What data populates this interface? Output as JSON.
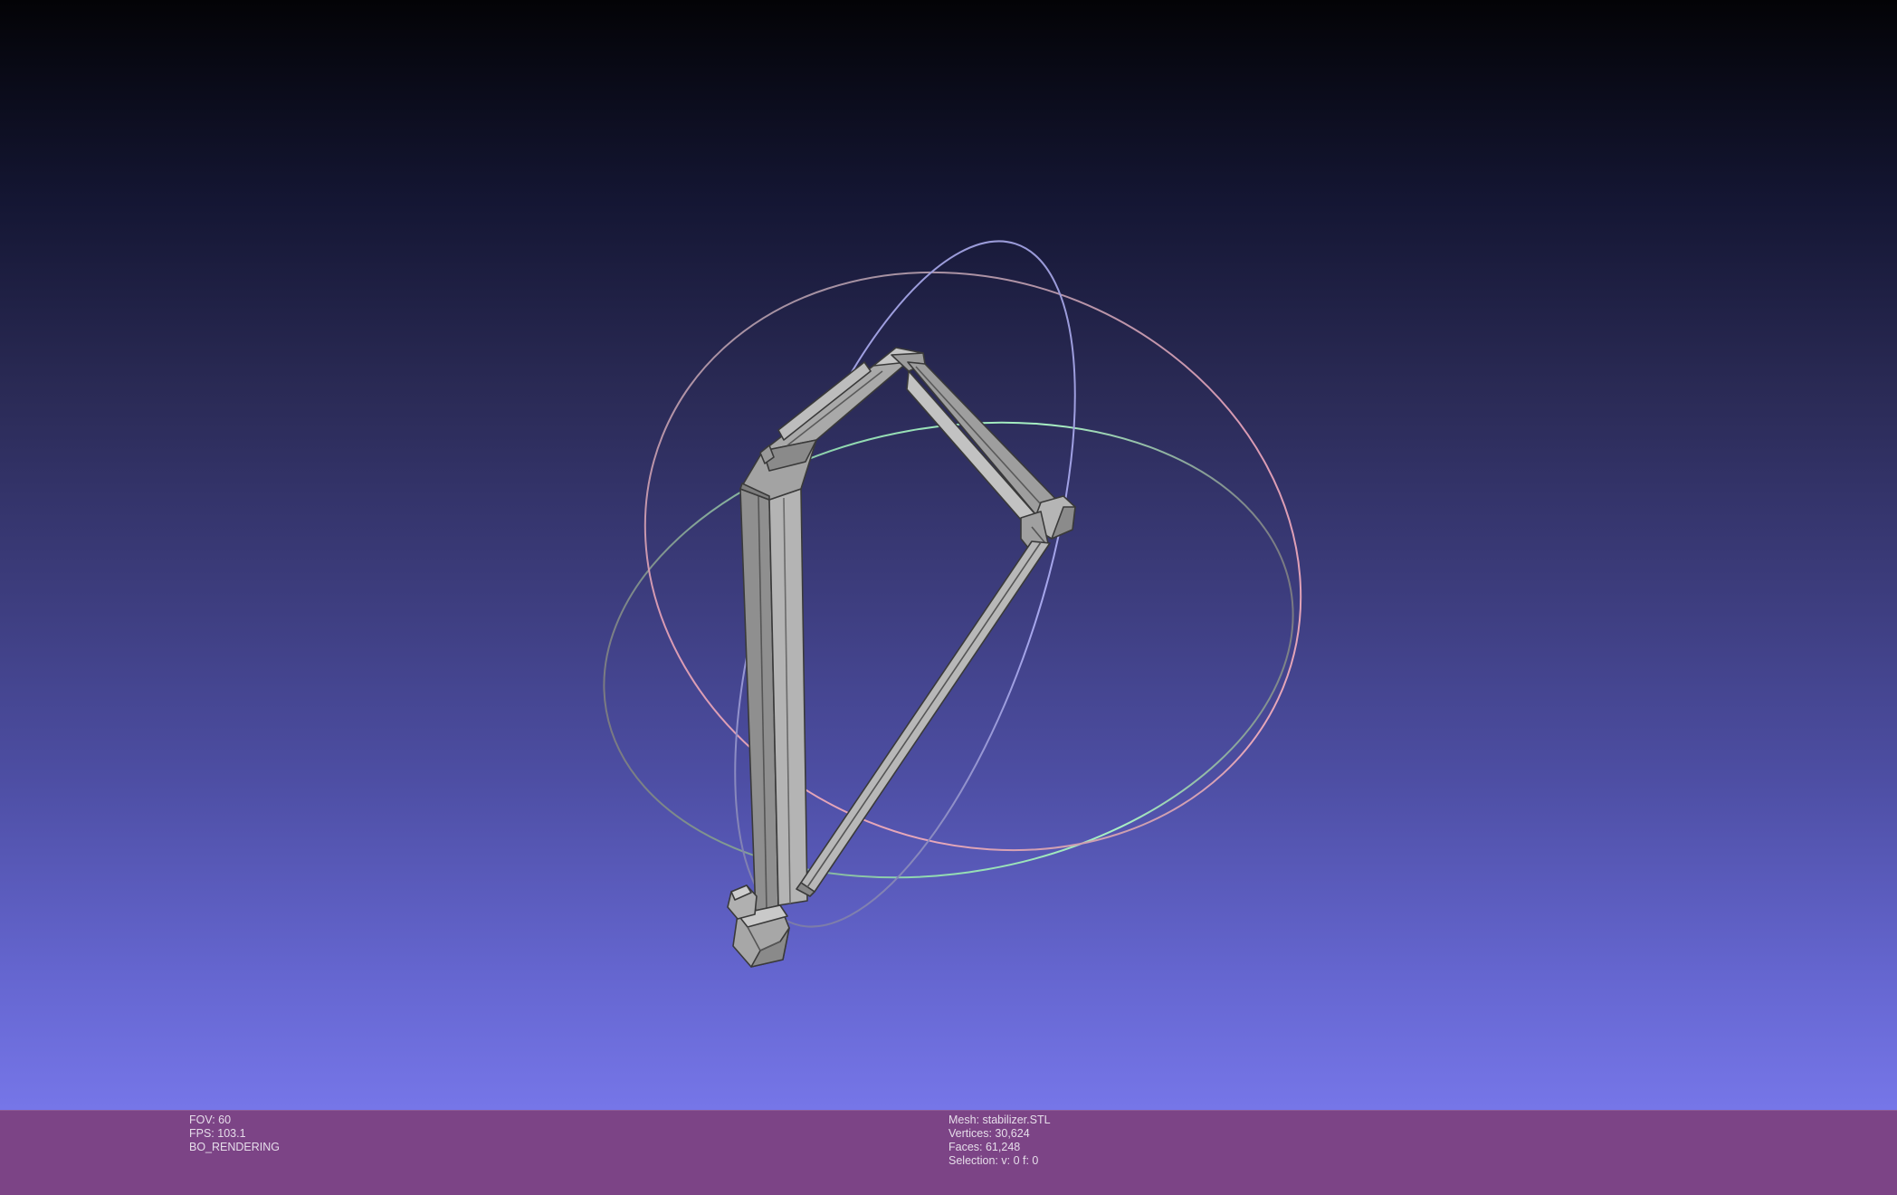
{
  "colors": {
    "info_bar": "#7c4486",
    "info_text": "#e6ddea",
    "mesh_fill": "#a9a9a9",
    "mesh_edge": "#3a3a3a"
  },
  "viewer": {
    "gizmo": "trackball-rotation-rings",
    "model": "stabilizer-frame"
  },
  "info_left": {
    "fov": "FOV: 60",
    "fps": "FPS:   103.1",
    "mode": "BO_RENDERING"
  },
  "info_right": {
    "mesh": "Mesh: stabilizer.STL",
    "vertices": "Vertices: 30,624",
    "faces": "Faces: 61,248",
    "selection": "Selection: v: 0 f: 0"
  }
}
